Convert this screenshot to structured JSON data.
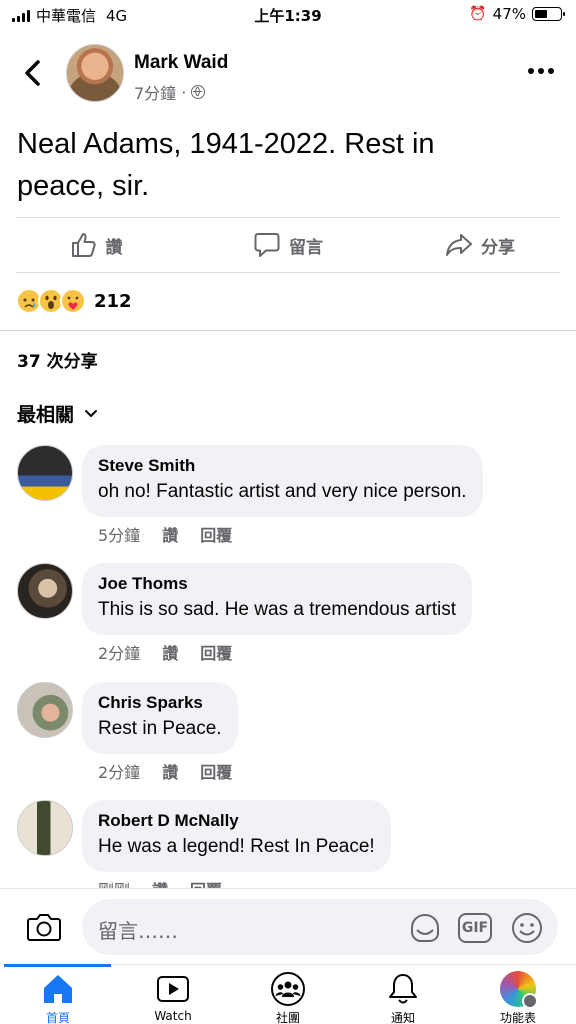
{
  "status": {
    "carrier": "中華電信",
    "network": "4G",
    "time": "上午1:39",
    "battery": "47%",
    "battery_level": 0.47
  },
  "post": {
    "author": "Mark Waid",
    "time": "7分鐘",
    "separator": "·",
    "text_line1": "Neal Adams, 1941-2022. Rest in",
    "text_line2": "peace, sir."
  },
  "actions": {
    "like": "讚",
    "comment": "留言",
    "share": "分享"
  },
  "reactions": {
    "count": "212",
    "types": [
      "sad",
      "wow",
      "care"
    ]
  },
  "shares": "37 次分享",
  "sort_label": "最相關",
  "comments": [
    {
      "name": "Steve Smith",
      "text": "oh no! Fantastic artist and very nice person.",
      "time": "5分鐘",
      "like": "讚",
      "reply": "回覆"
    },
    {
      "name": "Joe Thoms",
      "text": "This is so sad.  He was a tremendous artist",
      "time": "2分鐘",
      "like": "讚",
      "reply": "回覆"
    },
    {
      "name": "Chris Sparks",
      "text": "Rest in Peace.",
      "time": "2分鐘",
      "like": "讚",
      "reply": "回覆"
    },
    {
      "name": "Robert D McNally",
      "text": "He was a legend!  Rest In Peace!",
      "time": "剛剛",
      "like": "讚",
      "reply": "回覆"
    }
  ],
  "composer": {
    "placeholder": "留言……",
    "gif_label": "GIF"
  },
  "tabs": [
    {
      "label": "首頁",
      "icon": "home-icon",
      "active": true
    },
    {
      "label": "Watch",
      "icon": "watch-icon",
      "active": false
    },
    {
      "label": "社團",
      "icon": "groups-icon",
      "active": false
    },
    {
      "label": "通知",
      "icon": "bell-icon",
      "active": false
    },
    {
      "label": "功能表",
      "icon": "menu-icon",
      "active": false
    }
  ],
  "colors": {
    "accent": "#1877f2",
    "secondary_text": "#65676b",
    "bubble": "#f0f2f5"
  }
}
